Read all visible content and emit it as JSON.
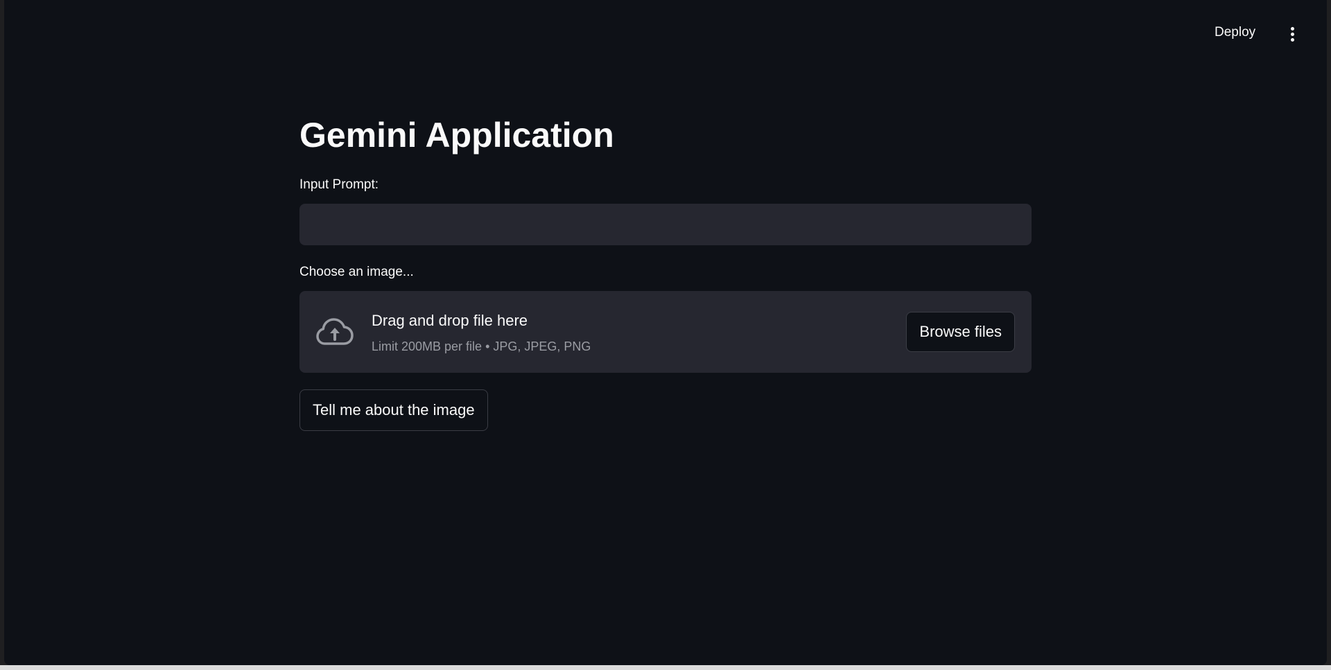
{
  "header": {
    "deploy_label": "Deploy",
    "menu_icon": "vertical-ellipsis-icon"
  },
  "main": {
    "title": "Gemini Application",
    "prompt": {
      "label": "Input Prompt:",
      "value": "",
      "placeholder": ""
    },
    "uploader": {
      "label": "Choose an image...",
      "icon": "cloud-upload-icon",
      "title": "Drag and drop file here",
      "subtitle": "Limit 200MB per file • JPG, JPEG, PNG",
      "browse_label": "Browse files"
    },
    "submit_label": "Tell me about the image"
  },
  "colors": {
    "background": "#0e1117",
    "panel": "#262730",
    "text": "#fafafa",
    "muted_text": "#9a9ca3",
    "button_border": "#3b3d45"
  }
}
